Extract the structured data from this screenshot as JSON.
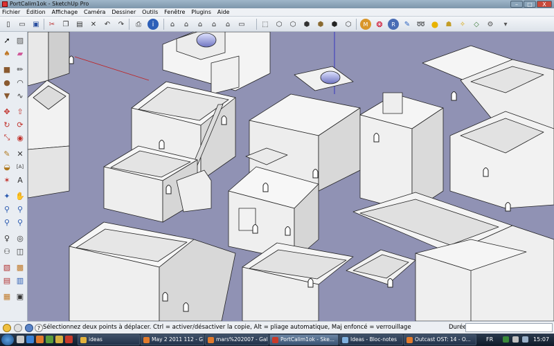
{
  "window": {
    "title": "PortCalim1ok - SketchUp Pro",
    "min_label": "–",
    "max_label": "□",
    "close_label": "X"
  },
  "menu": [
    "Fichier",
    "Édition",
    "Affichage",
    "Caméra",
    "Dessiner",
    "Outils",
    "Fenêtre",
    "Plugins",
    "Aide"
  ],
  "toolbar": {
    "icons": [
      "new-icon",
      "open-icon",
      "save-icon",
      "cut-icon",
      "copy-icon",
      "paste-icon",
      "erase-icon",
      "undo-icon",
      "redo-icon",
      "print-icon",
      "model-info-icon",
      "iso-view-icon",
      "top-view-icon",
      "front-view-icon",
      "right-view-icon",
      "back-view-icon",
      "left-view-icon",
      "xray-icon",
      "wireframe-icon",
      "hidden-line-icon",
      "shaded-icon",
      "shaded-texture-icon",
      "monochrome-icon",
      "plugin-m-icon",
      "plugin-s-icon",
      "plugin-r-icon",
      "plugin-tag-icon",
      "plugin-s2-icon",
      "plugin-dot-icon",
      "plugin-shadow-icon",
      "plugin-flag-icon",
      "plugin-diamond-icon",
      "plugin-gear-icon"
    ]
  },
  "palette": {
    "icons": [
      "select-icon",
      "component-icon",
      "paint-bucket-icon",
      "eraser-icon",
      "rectangle-icon",
      "line-icon",
      "circle-icon",
      "arc-icon",
      "polygon-icon",
      "freehand-icon",
      "move-icon",
      "push-pull-icon",
      "rotate-icon",
      "follow-me-icon",
      "scale-icon",
      "offset-icon",
      "tape-measure-icon",
      "dimension-icon",
      "protractor-icon",
      "text-icon",
      "axes-icon",
      "3d-text-icon",
      "orbit-icon",
      "pan-icon",
      "zoom-icon",
      "zoom-window-icon",
      "zoom-extents-icon",
      "previous-view-icon",
      "position-camera-icon",
      "walk-icon",
      "look-around-icon",
      "section-plane-icon",
      "sandbox-icon",
      "sandbox-smoove-icon",
      "warehouse-icon",
      "share-icon",
      "extension-icon",
      "layout-icon"
    ]
  },
  "status": {
    "text": "Sélectionnez deux points à déplacer.  Ctrl = activer/désactiver la copie, Alt = pliage automatique, Maj enfoncé = verrouillage",
    "vcb_label": "Durée",
    "vcb_value": ""
  },
  "taskbar": {
    "tasks": [
      {
        "label": "ideas",
        "color": "#e3b23c",
        "active": false
      },
      {
        "label": "May 2 2011 112 - G...",
        "color": "#e07a2c",
        "active": false
      },
      {
        "label": "mars%202007 - Gal...",
        "color": "#e07a2c",
        "active": false
      },
      {
        "label": "PortCalim1ok - Ske...",
        "color": "#c83a2a",
        "active": true
      },
      {
        "label": "Ideas - Bloc-notes",
        "color": "#7fb0de",
        "active": false
      },
      {
        "label": "Outcast OST: 14 - O...",
        "color": "#e07a2c",
        "active": false
      }
    ],
    "lang": "FR",
    "clock": "15:07"
  }
}
